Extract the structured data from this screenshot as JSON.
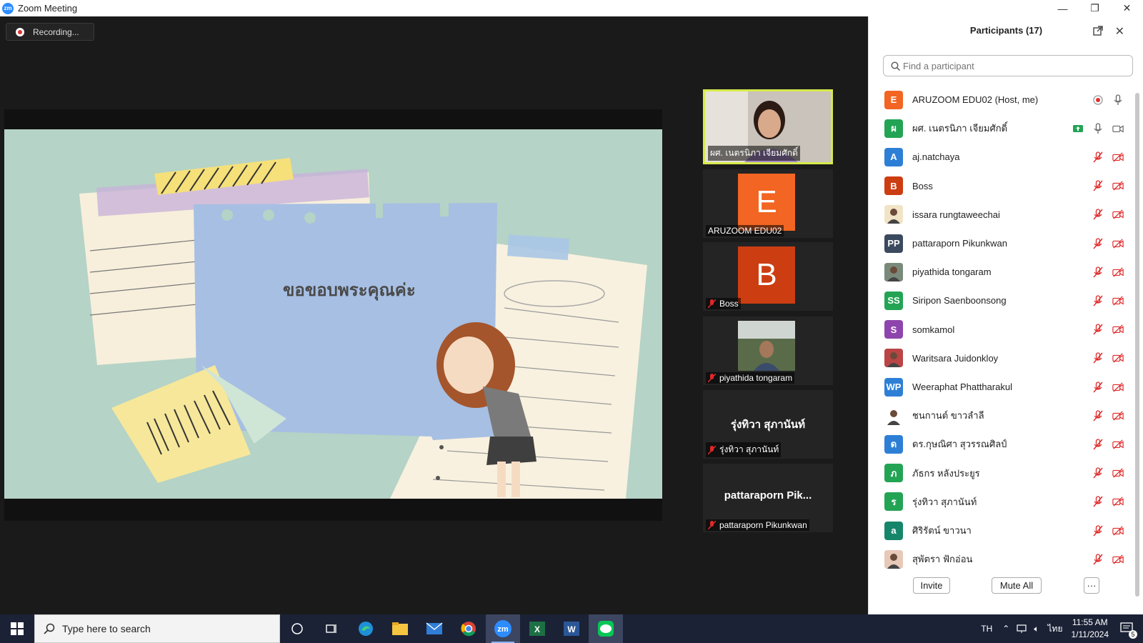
{
  "window": {
    "title": "Zoom Meeting",
    "minimize": "—",
    "maximize": "❐",
    "close": "✕"
  },
  "recording": {
    "label": "Recording..."
  },
  "slide": {
    "text": "ขอขอบพระคุณค่ะ"
  },
  "videos": [
    {
      "name": "ผศ. เนตรนิภา เจียมศักดิ์",
      "active": true,
      "type": "camera"
    },
    {
      "name": "ARUZOOM EDU02",
      "letter": "E",
      "color": "#f26522",
      "type": "letter"
    },
    {
      "name": "Boss",
      "letter": "B",
      "color": "#cc3d12",
      "muted": true,
      "type": "letter"
    },
    {
      "name": "piyathida tongaram",
      "muted": true,
      "type": "camera2"
    },
    {
      "name": "รุ่งทิวา สุภานันท์",
      "big": "รุ่งทิวา สุภานันท์",
      "muted": true,
      "type": "text"
    },
    {
      "name": "pattaraporn Pikunkwan",
      "big": "pattaraporn  Pik...",
      "muted": true,
      "type": "text"
    }
  ],
  "participants": {
    "title": "Participants (17)",
    "search_placeholder": "Find a participant",
    "invite": "Invite",
    "mute_all": "Mute All",
    "more": "···",
    "list": [
      {
        "name": "ARUZOOM EDU02 (Host, me)",
        "initials": "E",
        "color": "#f26522",
        "status": "host"
      },
      {
        "name": "ผศ. เนตรนิภา เจียมศักดิ์",
        "initials": "ผ",
        "color": "#23a454",
        "status": "live"
      },
      {
        "name": "aj.natchaya",
        "initials": "A",
        "color": "#2d7fd6",
        "status": "muted"
      },
      {
        "name": "Boss",
        "initials": "B",
        "color": "#cc3d12",
        "status": "muted"
      },
      {
        "name": "issara rungtaweechai",
        "initials": "",
        "color": "#f1e3c6",
        "status": "muted",
        "photo": true
      },
      {
        "name": "pattaraporn Pikunkwan",
        "initials": "PP",
        "color": "#3b4a5e",
        "status": "muted"
      },
      {
        "name": "piyathida tongaram",
        "initials": "",
        "color": "#7a8a7a",
        "status": "muted",
        "photo": true
      },
      {
        "name": "Siripon Saenboonsong",
        "initials": "SS",
        "color": "#23a454",
        "status": "muted"
      },
      {
        "name": "somkamol",
        "initials": "S",
        "color": "#8e44ad",
        "status": "muted"
      },
      {
        "name": "Waritsara Juidonkloy",
        "initials": "",
        "color": "#b44",
        "status": "muted",
        "photo": true
      },
      {
        "name": "Weeraphat Phattharakul",
        "initials": "WP",
        "color": "#2d7fd6",
        "status": "muted"
      },
      {
        "name": "ชนกานต์ ขาวลำลี",
        "initials": "",
        "color": "#ffffff",
        "status": "muted",
        "photo": true
      },
      {
        "name": "ดร.กุษณิศา สุวรรณศิลป์",
        "initials": "ด",
        "color": "#2d7fd6",
        "status": "muted"
      },
      {
        "name": "ภัธกร หลังประยูร",
        "initials": "ภ",
        "color": "#23a454",
        "status": "muted"
      },
      {
        "name": "รุ่งทิวา สุภานันท์",
        "initials": "ร",
        "color": "#23a454",
        "status": "muted"
      },
      {
        "name": "ศิริรัตน์ ขาวนา",
        "initials": "a",
        "color": "#16866a",
        "status": "muted"
      },
      {
        "name": "สุพัตรา ฟักอ่อน",
        "initials": "",
        "color": "#e8c9b8",
        "status": "muted",
        "photo": true
      }
    ]
  },
  "taskbar": {
    "search_placeholder": "Type here to search",
    "lang": "TH",
    "ime": "ไทย",
    "time": "11:55 AM",
    "date": "1/11/2024",
    "notifications": "5"
  }
}
